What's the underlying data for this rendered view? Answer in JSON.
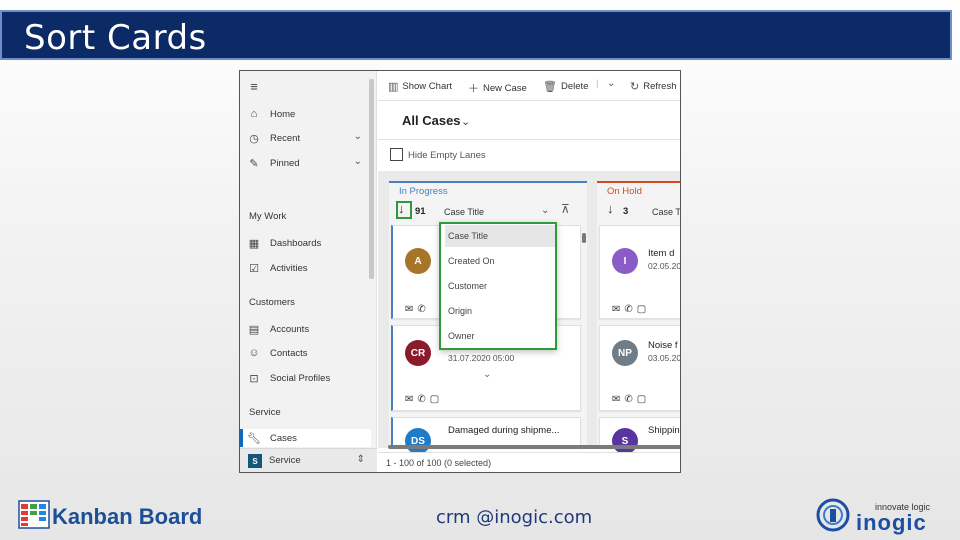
{
  "slide": {
    "title": "Sort Cards",
    "footer_email": "crm @inogic.com",
    "kanban_brand": "Kanban Board",
    "inogic_tagline": "innovate logic",
    "inogic_name": "inogic"
  },
  "colors": {
    "header_bg": "#0b2a66",
    "accent_green": "#2e9a3a",
    "in_progress_line": "#4a7fc0",
    "on_hold_line": "#d24a1e"
  },
  "nav": {
    "menu_icon": "hamburger-icon",
    "items_top": [
      {
        "label": "Home",
        "icon": "home-icon"
      },
      {
        "label": "Recent",
        "icon": "clock-icon"
      },
      {
        "label": "Pinned",
        "icon": "pin-icon"
      }
    ],
    "section_my_work": "My Work",
    "my_work_items": [
      {
        "label": "Dashboards",
        "icon": "dashboard-icon"
      },
      {
        "label": "Activities",
        "icon": "activities-icon"
      }
    ],
    "section_customers": "Customers",
    "customer_items": [
      {
        "label": "Accounts",
        "icon": "building-icon"
      },
      {
        "label": "Contacts",
        "icon": "person-icon"
      },
      {
        "label": "Social Profiles",
        "icon": "social-icon"
      }
    ],
    "section_service": "Service",
    "service_items": [
      {
        "label": "Cases",
        "icon": "wrench-icon"
      }
    ],
    "area_badge": "S",
    "area_label": "Service"
  },
  "commandbar": {
    "show_chart": "Show Chart",
    "new_case": "New Case",
    "delete": "Delete",
    "refresh": "Refresh"
  },
  "view": {
    "title": "All Cases",
    "hide_empty_lanes": "Hide Empty Lanes"
  },
  "lanes": [
    {
      "title": "In Progress",
      "count": "91",
      "sort_field": "Case Title",
      "cards": [
        {
          "avatar": "A",
          "avatar_color": "#a8742a",
          "title": "",
          "sub": ""
        },
        {
          "avatar": "CR",
          "avatar_color": "#8b1a2b",
          "title": "",
          "sub": "31.07.2020 05:00"
        },
        {
          "avatar": "DS",
          "avatar_color": "#1e7bc8",
          "title": "Damaged during shipme...",
          "sub": ""
        }
      ]
    },
    {
      "title": "On Hold",
      "count": "3",
      "sort_field": "Case T",
      "cards": [
        {
          "avatar": "I",
          "avatar_color": "#8a5cc8",
          "title": "Item d",
          "sub": "02.05.20"
        },
        {
          "avatar": "NP",
          "avatar_color": "#6f7d88",
          "title": "Noise f",
          "sub": "03.05.20"
        },
        {
          "avatar": "S",
          "avatar_color": "#5a35a0",
          "title": "Shippin",
          "sub": ""
        }
      ]
    }
  ],
  "sort_dropdown": {
    "options": [
      "Case Title",
      "Created On",
      "Customer",
      "Origin",
      "Owner"
    ],
    "selected": "Case Title"
  },
  "status": {
    "text": "1 - 100 of 100 (0 selected)"
  }
}
